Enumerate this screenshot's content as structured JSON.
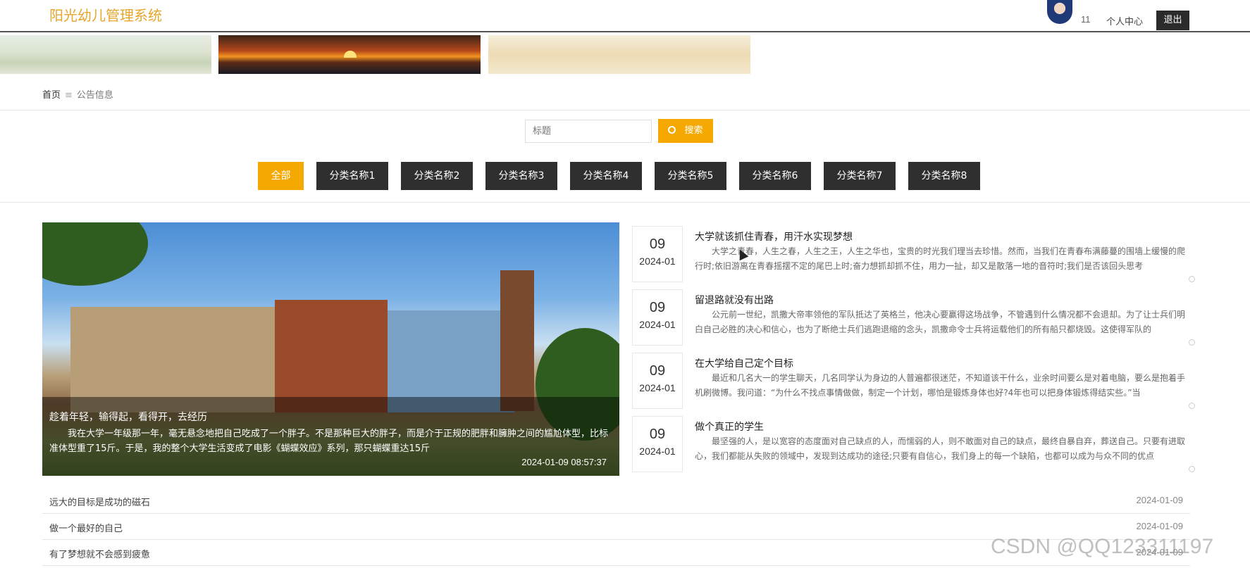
{
  "header": {
    "brand": "阳光幼儿管理系统",
    "user_id": "11",
    "profile_label": "个人中心",
    "logout_label": "退出"
  },
  "breadcrumb": {
    "home": "首页",
    "separator": "≡",
    "current": "公告信息"
  },
  "search": {
    "placeholder": "标题",
    "button_label": "搜索"
  },
  "categories": [
    "全部",
    "分类名称1",
    "分类名称2",
    "分类名称3",
    "分类名称4",
    "分类名称5",
    "分类名称6",
    "分类名称7",
    "分类名称8"
  ],
  "active_category": "全部",
  "featured": {
    "title": "趁着年轻，输得起，看得开，去经历",
    "description": "我在大学一年级那一年，毫无悬念地把自己吃成了一个胖子。不是那种巨大的胖子，而是介于正规的肥胖和臃肿之间的尴尬体型，比标准体型重了15斤。于是，我的整个大学生活变成了电影《蝴蝶效应》系列，那只蝴蝶重达15斤",
    "datetime": "2024-01-09 08:57:37"
  },
  "news": [
    {
      "day": "09",
      "month": "2024-01",
      "title": "大学就该抓住青春，用汗水实现梦想",
      "summary": "大学之青春，人生之春，人生之王，人生之华也，宝贵的时光我们理当去珍惜。然而，当我们在青春布满藤蔓的围墙上缓慢的爬行时;依旧游离在青春摇摆不定的尾巴上时;奋力想抓却抓不住，用力一扯，却又是散落一地的音符时;我们是否该回头思考"
    },
    {
      "day": "09",
      "month": "2024-01",
      "title": "留退路就没有出路",
      "summary": "公元前一世纪，凯撒大帝率领他的军队抵达了英格兰，他决心要赢得这场战争，不管遇到什么情况都不会退却。为了让士兵们明白自己必胜的决心和信心，也为了断绝士兵们逃跑退缩的念头，凯撒命令士兵将运载他们的所有船只都烧毁。这使得军队的"
    },
    {
      "day": "09",
      "month": "2024-01",
      "title": "在大学给自己定个目标",
      "summary": "最近和几名大一的学生聊天，几名同学认为身边的人普遍都很迷茫，不知道该干什么，业余时间要么是对着电脑，要么是抱着手机刷微博。我问道：“为什么不找点事情做做，制定一个计划，哪怕是锻炼身体也好?4年也可以把身体锻炼得结实些。”当"
    },
    {
      "day": "09",
      "month": "2024-01",
      "title": "做个真正的学生",
      "summary": "最坚强的人，是以宽容的态度面对自己缺点的人，而懦弱的人，则不敢面对自己的缺点，最终自暴自弃，葬送自己。只要有进取心，我们都能从失败的领域中，发现到达成功的途径;只要有自信心，我们身上的每一个缺陷，也都可以成为与众不同的优点"
    }
  ],
  "list": [
    {
      "title": "远大的目标是成功的磁石",
      "date": "2024-01-09"
    },
    {
      "title": "做一个最好的自己",
      "date": "2024-01-09"
    },
    {
      "title": "有了梦想就不会感到疲惫",
      "date": "2024-01-09"
    }
  ],
  "watermark": "CSDN @QQ123311197",
  "colors": {
    "brand": "#e7a52a",
    "accent": "#f5a900",
    "dark_button": "#2f2f2f"
  }
}
